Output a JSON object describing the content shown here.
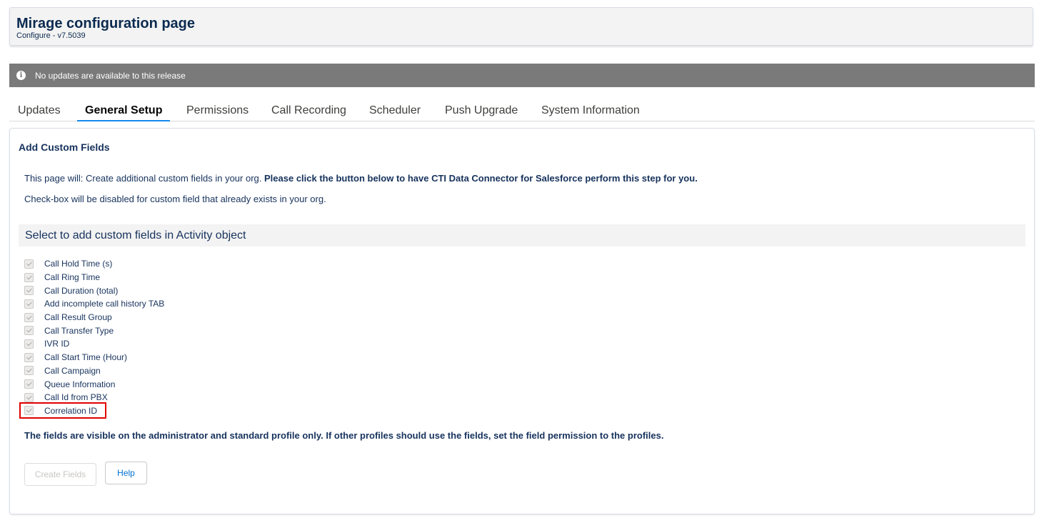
{
  "header": {
    "title": "Mirage configuration page",
    "subtitle": "Configure - v7.5039"
  },
  "notice": {
    "icon": "info-icon",
    "text": "No updates are available to this release"
  },
  "tabs": [
    {
      "label": "Updates",
      "active": false
    },
    {
      "label": "General Setup",
      "active": true
    },
    {
      "label": "Permissions",
      "active": false
    },
    {
      "label": "Call Recording",
      "active": false
    },
    {
      "label": "Scheduler",
      "active": false
    },
    {
      "label": "Push Upgrade",
      "active": false
    },
    {
      "label": "System Information",
      "active": false
    }
  ],
  "panel": {
    "title": "Add Custom Fields",
    "description_plain": "This page will: Create additional custom fields in your org.",
    "description_bold": "Please click the button below to have CTI Data Connector for Salesforce perform this step for you.",
    "checkbox_note": "Check-box will be disabled for custom field that already exists in your org.",
    "section_title": "Select to add custom fields in Activity object",
    "fields": [
      {
        "label": "Call Hold Time (s)",
        "checked": true,
        "disabled": true
      },
      {
        "label": "Call Ring Time",
        "checked": true,
        "disabled": true
      },
      {
        "label": "Call Duration (total)",
        "checked": true,
        "disabled": true
      },
      {
        "label": "Add incomplete call history TAB",
        "checked": true,
        "disabled": true
      },
      {
        "label": "Call Result Group",
        "checked": true,
        "disabled": true
      },
      {
        "label": "Call Transfer Type",
        "checked": true,
        "disabled": true
      },
      {
        "label": "IVR ID",
        "checked": true,
        "disabled": true
      },
      {
        "label": "Call Start Time (Hour)",
        "checked": true,
        "disabled": true
      },
      {
        "label": "Call Campaign",
        "checked": true,
        "disabled": true
      },
      {
        "label": "Queue Information",
        "checked": true,
        "disabled": true
      },
      {
        "label": "Call Id from PBX",
        "checked": true,
        "disabled": true
      },
      {
        "label": "Correlation ID",
        "checked": true,
        "disabled": true
      }
    ],
    "visibility_note": "The fields are visible on the administrator and standard profile only. If other profiles should use the fields, set the field permission to the profiles.",
    "buttons": {
      "create_fields": "Create Fields",
      "help": "Help"
    }
  },
  "colors": {
    "title_text": "#0b2a4f",
    "notice_bg": "#7a7a7a",
    "active_tab_underline": "#1589ee",
    "highlight_border": "#e00000",
    "link_blue": "#0070d2"
  }
}
